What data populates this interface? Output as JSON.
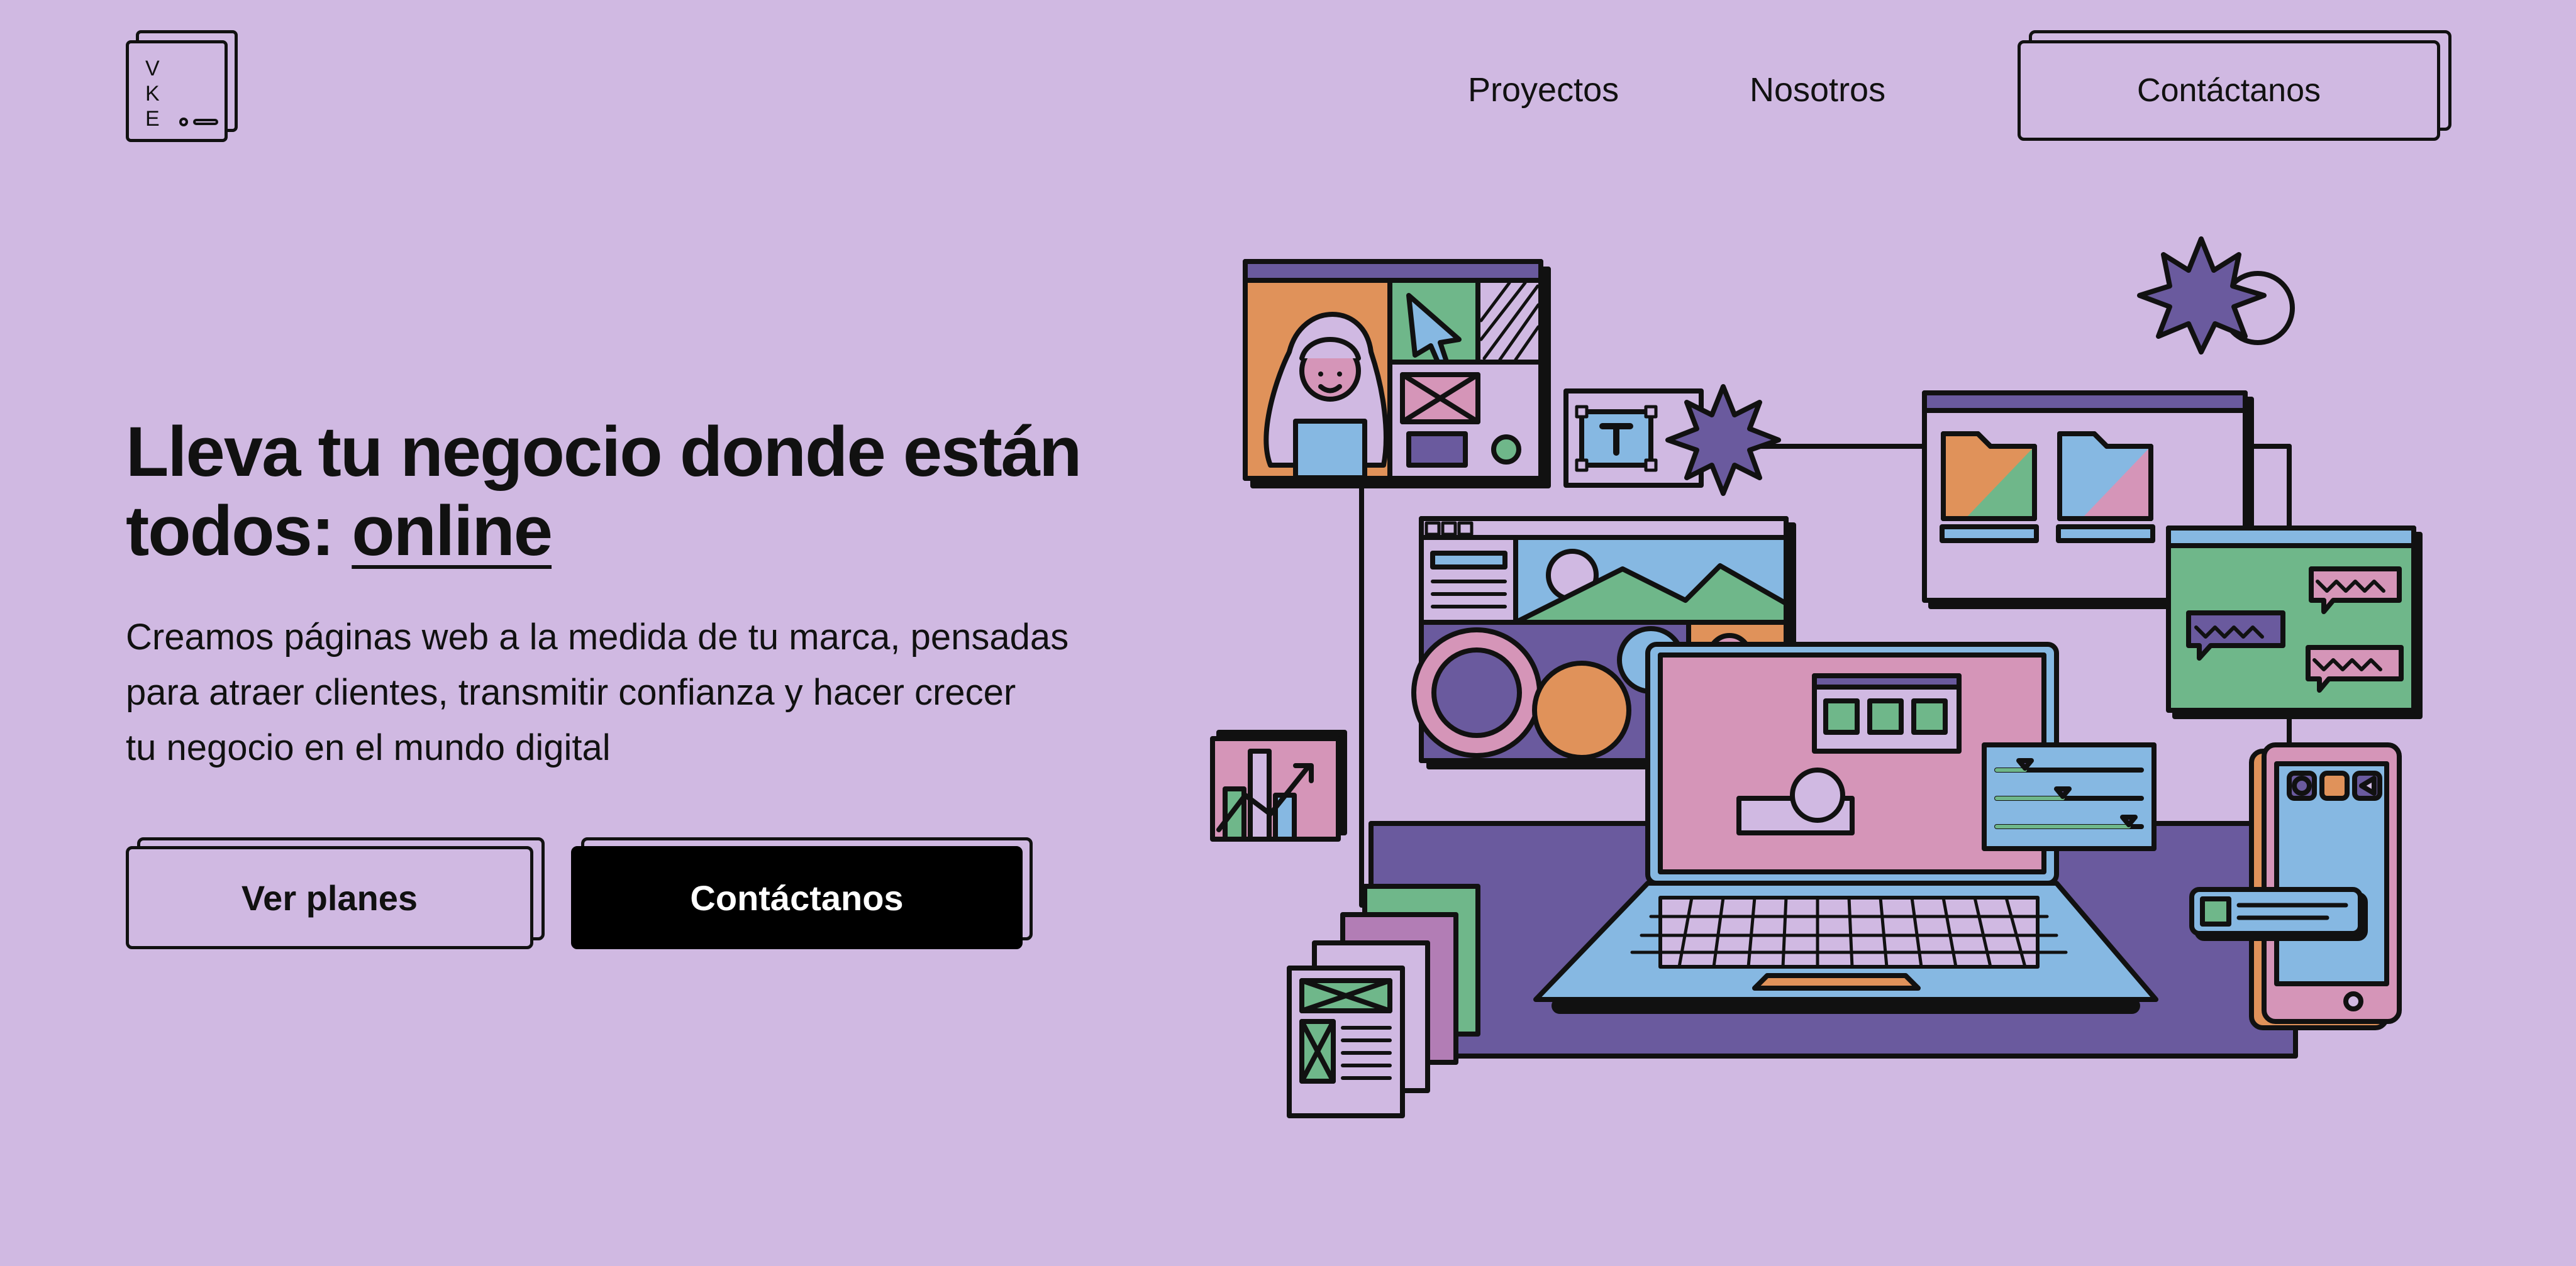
{
  "header": {
    "logo_letters": [
      "V",
      "K",
      "E"
    ],
    "nav": [
      {
        "label": "Proyectos"
      },
      {
        "label": "Nosotros"
      }
    ],
    "cta_label": "Contáctanos"
  },
  "hero": {
    "title_line1": "Lleva tu negocio donde están",
    "title_prefix": "todos: ",
    "title_highlight": "online",
    "subtitle_line1": "Creamos páginas web a la medida de tu marca, pensadas",
    "subtitle_line2": "para atraer clientes, transmitir confianza y hacer crecer",
    "subtitle_line3": "tu negocio en el mundo digital",
    "primary_label": "Ver planes",
    "secondary_label": "Contáctanos"
  },
  "illustration": {
    "name": "web-design-illustration",
    "colors": {
      "background": "#D0B9E2",
      "purple": "#6A5A9E",
      "blue": "#86B8E2",
      "green": "#6FB78A",
      "orange": "#E0925A",
      "pink": "#D595B8",
      "ink": "#111111"
    }
  }
}
